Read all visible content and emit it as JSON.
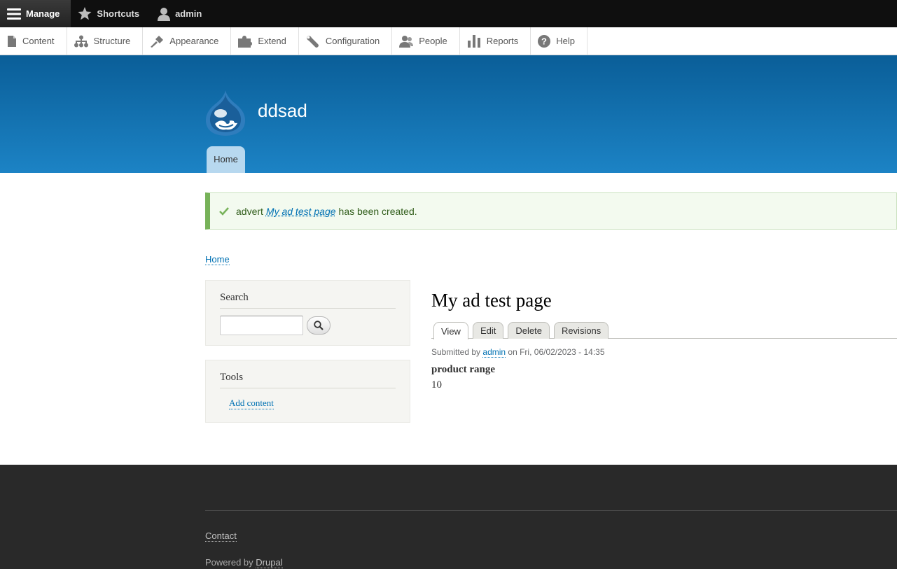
{
  "toolbar": {
    "manage_label": "Manage",
    "shortcuts_label": "Shortcuts",
    "user_label": "admin"
  },
  "tray": {
    "items": [
      {
        "label": "Content",
        "icon": "file-icon"
      },
      {
        "label": "Structure",
        "icon": "sitemap-icon"
      },
      {
        "label": "Appearance",
        "icon": "brush-icon"
      },
      {
        "label": "Extend",
        "icon": "puzzle-icon"
      },
      {
        "label": "Configuration",
        "icon": "wrench-icon"
      },
      {
        "label": "People",
        "icon": "people-icon"
      },
      {
        "label": "Reports",
        "icon": "bar-chart-icon"
      },
      {
        "label": "Help",
        "icon": "help-icon"
      }
    ]
  },
  "header": {
    "site_name": "ddsad",
    "nav_home": "Home"
  },
  "status": {
    "prefix": "advert",
    "link": "My ad test page",
    "suffix": "has been created."
  },
  "breadcrumb": {
    "home": "Home"
  },
  "sidebar": {
    "search_title": "Search",
    "tools_title": "Tools",
    "add_content": "Add content"
  },
  "node": {
    "title": "My ad test page",
    "tabs": [
      "View",
      "Edit",
      "Delete",
      "Revisions"
    ],
    "submitted_prefix": "Submitted by",
    "author": "admin",
    "submitted_date": "on Fri, 06/02/2023 - 14:35",
    "field_label": "product range",
    "field_value": "10"
  },
  "footer": {
    "contact": "Contact",
    "powered_prefix": "Powered by",
    "powered_link": "Drupal"
  },
  "colors": {
    "header_top": "#0a5e98",
    "header_bottom": "#1c83c5",
    "link": "#0071b3",
    "status_border": "#77b259",
    "footer": "#292929"
  }
}
